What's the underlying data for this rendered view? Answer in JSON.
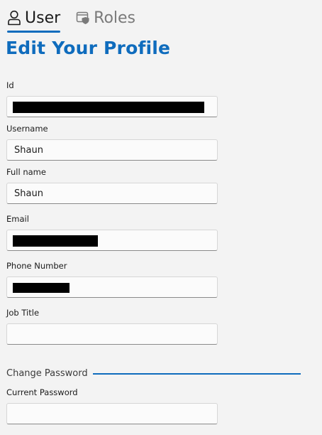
{
  "tabs": [
    {
      "label": "User",
      "icon": "user-icon",
      "active": true
    },
    {
      "label": "Roles",
      "icon": "shield-icon",
      "active": false
    }
  ],
  "page_title": "Edit Your Profile",
  "fields": {
    "id": {
      "label": "Id",
      "value": "",
      "redacted": true
    },
    "username": {
      "label": "Username",
      "value": "Shaun"
    },
    "full_name": {
      "label": "Full name",
      "value": "Shaun"
    },
    "email": {
      "label": "Email",
      "value": "",
      "redacted": true
    },
    "phone": {
      "label": "Phone Number",
      "value": "",
      "redacted": true
    },
    "job_title": {
      "label": "Job Title",
      "value": ""
    }
  },
  "change_password": {
    "section_title": "Change Password",
    "current_password": {
      "label": "Current Password",
      "value": ""
    }
  },
  "colors": {
    "accent": "#0f6cbd",
    "background": "#f3f3f3",
    "redaction": "#000000"
  }
}
